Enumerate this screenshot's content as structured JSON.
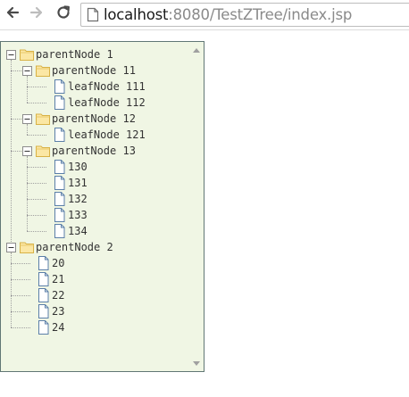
{
  "browser": {
    "url_host": "localhost",
    "url_rest": ":8080/TestZTree/index.jsp"
  },
  "tree": {
    "nodes": [
      {
        "label": "parentNode 1",
        "type": "folder"
      },
      {
        "label": "parentNode 11",
        "type": "folder"
      },
      {
        "label": "leafNode 111",
        "type": "leaf"
      },
      {
        "label": "leafNode 112",
        "type": "leaf"
      },
      {
        "label": "parentNode 12",
        "type": "folder"
      },
      {
        "label": "leafNode 121",
        "type": "leaf"
      },
      {
        "label": "parentNode 13",
        "type": "folder"
      },
      {
        "label": "130",
        "type": "leaf"
      },
      {
        "label": "131",
        "type": "leaf"
      },
      {
        "label": "132",
        "type": "leaf"
      },
      {
        "label": "133",
        "type": "leaf"
      },
      {
        "label": "134",
        "type": "leaf"
      },
      {
        "label": "parentNode 2",
        "type": "folder"
      },
      {
        "label": "20",
        "type": "leaf"
      },
      {
        "label": "21",
        "type": "leaf"
      },
      {
        "label": "22",
        "type": "leaf"
      },
      {
        "label": "23",
        "type": "leaf"
      },
      {
        "label": "24",
        "type": "leaf"
      }
    ]
  },
  "colors": {
    "tree_background": "#f0f6e4",
    "tree_border": "#617775",
    "folder_fill": "#fbe7a4",
    "leaf_outline": "#5b7fa8"
  }
}
